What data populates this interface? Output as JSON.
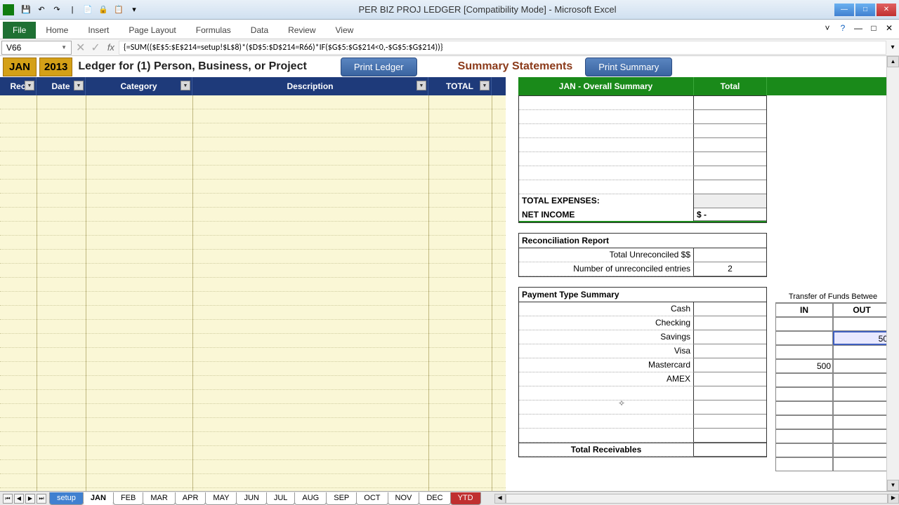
{
  "app": {
    "title": "PER BIZ PROJ LEDGER  [Compatibility Mode] - Microsoft Excel"
  },
  "ribbon": {
    "tabs": [
      "File",
      "Home",
      "Insert",
      "Page Layout",
      "Formulas",
      "Data",
      "Review",
      "View"
    ]
  },
  "formula": {
    "cell_ref": "V66",
    "value": "{=SUM(($E$5:$E$214=setup!$L$8)*($D$5:$D$214=R66)*IF($G$5:$G$214<0,-$G$5:$G$214))}"
  },
  "ledger": {
    "month": "JAN",
    "year": "2013",
    "title": "Ledger for (1) Person, Business, or Project",
    "print_ledger": "Print Ledger",
    "summary_title": "Summary Statements",
    "print_summary": "Print Summary",
    "headers": {
      "rec": "Rec",
      "date": "Date",
      "category": "Category",
      "description": "Description",
      "total": "TOTAL"
    }
  },
  "summary": {
    "header_main": "JAN - Overall Summary",
    "header_total": "Total",
    "total_expenses": "TOTAL EXPENSES:",
    "net_income": "NET INCOME",
    "net_income_val": "$                    -",
    "recon": {
      "title": "Reconciliation Report",
      "unrec_dollars": "Total Unreconciled $$",
      "unrec_entries": "Number of unreconciled entries",
      "unrec_entries_val": "2"
    },
    "payment": {
      "title": "Payment Type Summary",
      "types": [
        "Cash",
        "Checking",
        "Savings",
        "Visa",
        "Mastercard",
        "AMEX"
      ],
      "total_recv": "Total Receivables"
    },
    "transfer": {
      "title": "Transfer of Funds Betwee",
      "in": "IN",
      "out": "OUT",
      "checking_out": "50",
      "visa_in": "500"
    }
  },
  "tabs": {
    "list": [
      "setup",
      "JAN",
      "FEB",
      "MAR",
      "APR",
      "MAY",
      "JUN",
      "JUL",
      "AUG",
      "SEP",
      "OCT",
      "NOV",
      "DEC",
      "YTD"
    ],
    "active": "JAN"
  }
}
